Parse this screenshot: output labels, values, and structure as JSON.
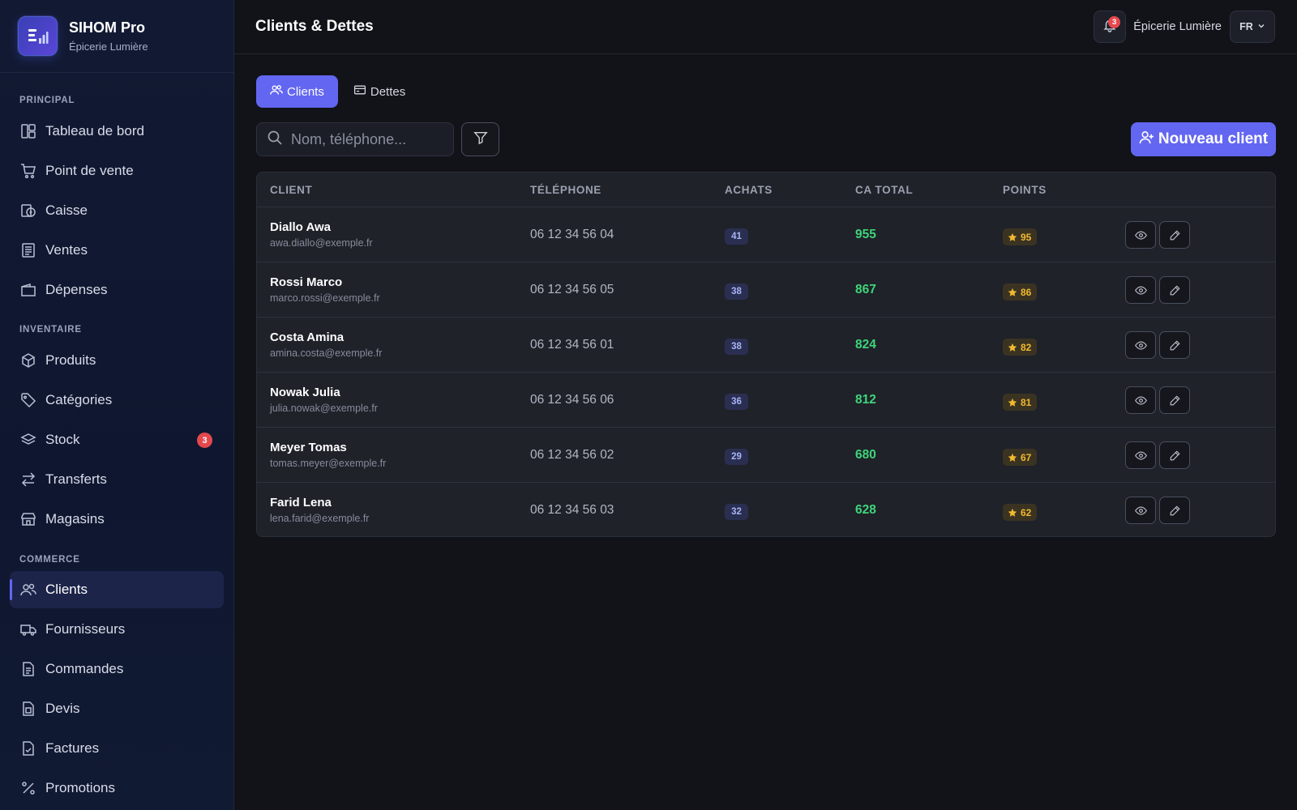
{
  "brand": {
    "name": "SIHOM Pro",
    "subtitle": "Épicerie Lumière"
  },
  "sidebar": {
    "sections": [
      {
        "label": "PRINCIPAL"
      },
      {
        "label": "INVENTAIRE"
      },
      {
        "label": "COMMERCE"
      }
    ],
    "items": [
      {
        "label": "Tableau de bord",
        "icon": "dashboard-icon"
      },
      {
        "label": "Point de vente",
        "icon": "cart-icon"
      },
      {
        "label": "Caisse",
        "icon": "cash-register-icon"
      },
      {
        "label": "Ventes",
        "icon": "receipt-icon"
      },
      {
        "label": "Dépenses",
        "icon": "wallet-icon"
      },
      {
        "label": "Produits",
        "icon": "box-icon"
      },
      {
        "label": "Catégories",
        "icon": "tag-icon"
      },
      {
        "label": "Stock",
        "icon": "layers-icon",
        "badge": "3"
      },
      {
        "label": "Transferts",
        "icon": "transfer-icon"
      },
      {
        "label": "Magasins",
        "icon": "store-icon"
      },
      {
        "label": "Clients",
        "icon": "users-icon",
        "active": true
      },
      {
        "label": "Fournisseurs",
        "icon": "truck-icon"
      },
      {
        "label": "Commandes",
        "icon": "document-icon"
      },
      {
        "label": "Devis",
        "icon": "quote-icon"
      },
      {
        "label": "Factures",
        "icon": "invoice-icon"
      },
      {
        "label": "Promotions",
        "icon": "percent-icon"
      }
    ]
  },
  "header": {
    "title": "Clients & Dettes",
    "notifications": "3",
    "store": "Épicerie Lumière",
    "language": "FR"
  },
  "tabs": [
    {
      "label": "Clients",
      "active": true
    },
    {
      "label": "Dettes",
      "active": false
    }
  ],
  "toolbar": {
    "search_placeholder": "Nom, téléphone...",
    "new_client_label": "Nouveau client"
  },
  "table": {
    "columns": [
      "CLIENT",
      "TÉLÉPHONE",
      "ACHATS",
      "CA TOTAL",
      "POINTS"
    ],
    "rows": [
      {
        "name": "Diallo Awa",
        "email": "awa.diallo@exemple.fr",
        "phone": "06 12 34 56 04",
        "achats": "41",
        "ca": "955",
        "points": "95"
      },
      {
        "name": "Rossi Marco",
        "email": "marco.rossi@exemple.fr",
        "phone": "06 12 34 56 05",
        "achats": "38",
        "ca": "867",
        "points": "86"
      },
      {
        "name": "Costa Amina",
        "email": "amina.costa@exemple.fr",
        "phone": "06 12 34 56 01",
        "achats": "38",
        "ca": "824",
        "points": "82"
      },
      {
        "name": "Nowak Julia",
        "email": "julia.nowak@exemple.fr",
        "phone": "06 12 34 56 06",
        "achats": "36",
        "ca": "812",
        "points": "81"
      },
      {
        "name": "Meyer Tomas",
        "email": "tomas.meyer@exemple.fr",
        "phone": "06 12 34 56 02",
        "achats": "29",
        "ca": "680",
        "points": "67"
      },
      {
        "name": "Farid Lena",
        "email": "lena.farid@exemple.fr",
        "phone": "06 12 34 56 03",
        "achats": "32",
        "ca": "628",
        "points": "62"
      }
    ]
  },
  "colors": {
    "accent": "#6366f1",
    "positive": "#3fd47a",
    "points": "#f1b92f",
    "alert": "#e5484d"
  }
}
